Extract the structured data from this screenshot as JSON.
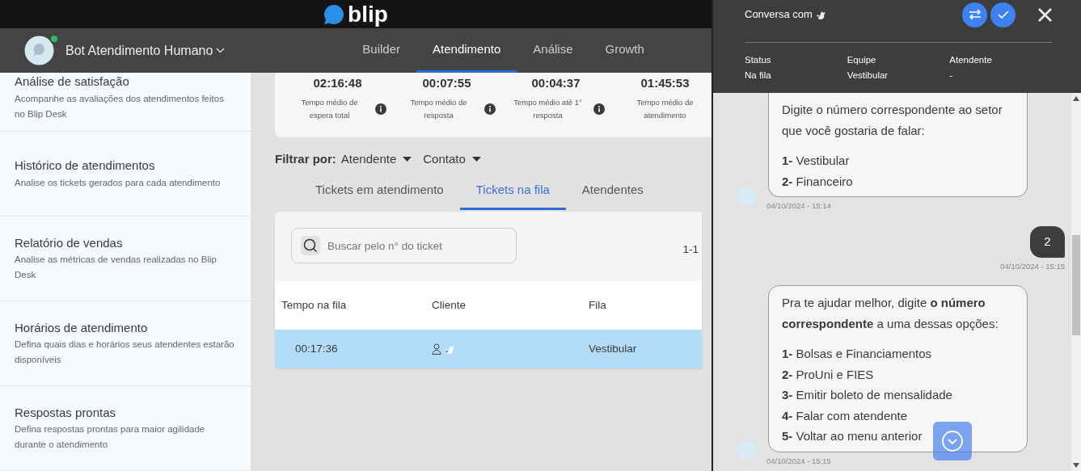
{
  "brand": {
    "logo_text": "blip"
  },
  "bot": {
    "name": "Bot Atendimento Humano",
    "online": true
  },
  "nav_tabs": [
    {
      "label": "Builder",
      "selected": false
    },
    {
      "label": "Atendimento",
      "selected": true
    },
    {
      "label": "Análise",
      "selected": false
    },
    {
      "label": "Growth",
      "selected": false
    }
  ],
  "sidebar": {
    "items": [
      {
        "title": "Análise de satisfação",
        "description": "Acompanhe as avaliações dos atendimentos feitos no Blip Desk"
      },
      {
        "title": "Histórico de atendimentos",
        "description": "Analise os tickets gerados para cada atendimento"
      },
      {
        "title": "Relatório de vendas",
        "description": "Analise as métricas de vendas realizadas no Blip Desk"
      },
      {
        "title": "Horários de atendimento",
        "description": "Defina quais dias e horários seus atendentes estarão disponíveis"
      },
      {
        "title": "Respostas prontas",
        "description": "Defina respostas prontas para maior agilidade durante o atendimento"
      }
    ]
  },
  "stats": [
    {
      "value": "02:16:48",
      "label": "Tempo médio de espera total",
      "info": true
    },
    {
      "value": "00:07:55",
      "label": "Tempo médio de resposta",
      "info": true
    },
    {
      "value": "00:04:37",
      "label": "Tempo médio até 1° resposta",
      "info": true
    },
    {
      "value": "01:45:53",
      "label": "Tempo médio de atendimento",
      "info": false
    }
  ],
  "filter": {
    "label": "Filtrar por:",
    "options": [
      "Atendente",
      "Contato"
    ]
  },
  "ticket_tabs": [
    {
      "label": "Tickets em atendimento",
      "selected": false
    },
    {
      "label": "Tickets na fila",
      "selected": true
    },
    {
      "label": "Atendentes",
      "selected": false
    }
  ],
  "search": {
    "placeholder": "Buscar pelo n° do ticket"
  },
  "pagination": "1-1",
  "table": {
    "columns": [
      "Tempo na fila",
      "Cliente",
      "Fila"
    ],
    "rows": [
      {
        "cells": [
          "00:17:36",
          "",
          "Vestibular"
        ],
        "selected": true
      }
    ]
  },
  "conversation": {
    "title": "Conversa com",
    "info": [
      {
        "label": "Status",
        "value": "Na fila"
      },
      {
        "label": "Equipe",
        "value": "Vestibular"
      },
      {
        "label": "Atendente",
        "value": "-"
      }
    ],
    "messages": [
      {
        "kind": "bot",
        "paragraphs": [
          [
            "Digite o número correspondente ao setor que você gostaria de falar:"
          ],
          [
            "**1-** Vestibular",
            "**2-** Financeiro"
          ]
        ],
        "time": "04/10/2024 - 15:14"
      },
      {
        "kind": "user",
        "paragraphs": [
          [
            "2"
          ]
        ],
        "time": "04/10/2024 - 15:15"
      },
      {
        "kind": "bot",
        "paragraphs": [
          [
            "Pra te ajudar melhor, digite **o número correspondente** a uma dessas opções:"
          ],
          [
            "**1-** Bolsas e Financiamentos",
            "**2-** ProUni e FIES",
            "**3-** Emitir boleto de mensalidade",
            "**4-** Falar com atendente",
            "**5-** Voltar ao menu anterior"
          ]
        ],
        "time": "04/10/2024 - 15:15"
      }
    ]
  }
}
